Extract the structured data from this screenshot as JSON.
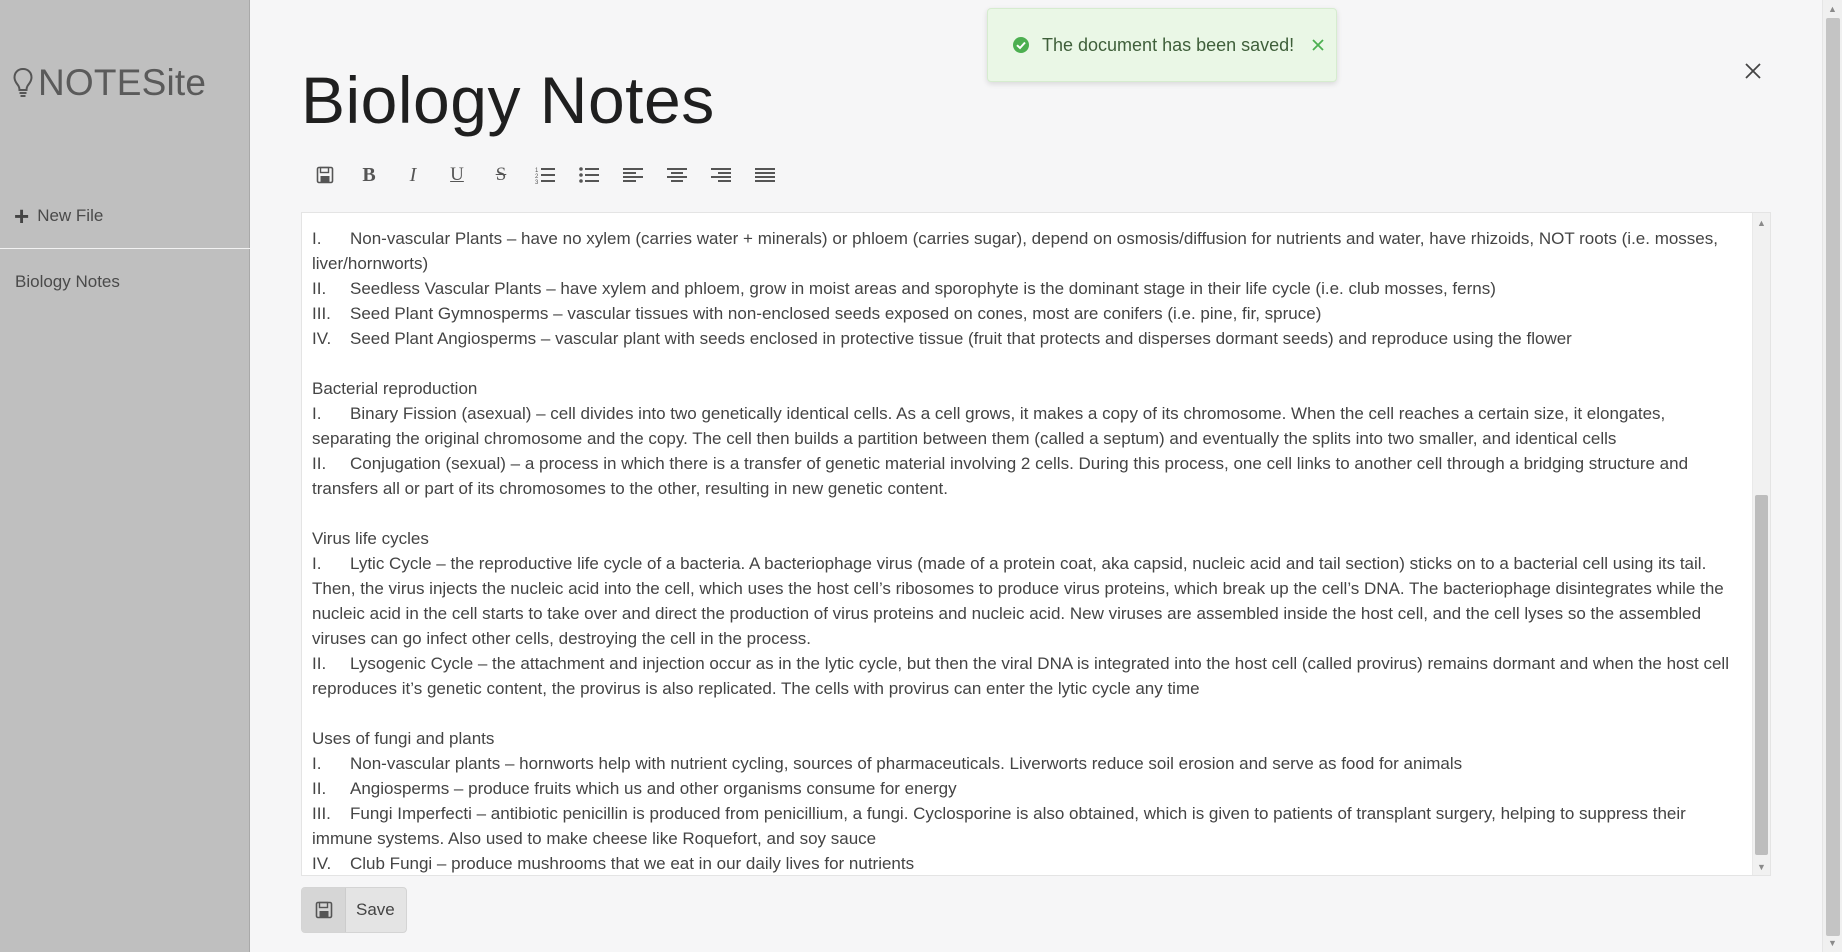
{
  "brand": {
    "name": "NOTESite",
    "icon": "lightbulb-icon"
  },
  "sidebar": {
    "new_file_label": "New File",
    "new_file_icon": "plus-icon",
    "files": [
      "Biology Notes"
    ]
  },
  "document": {
    "title": "Biology Notes"
  },
  "toast": {
    "message": "The document has been saved!",
    "icon": "check-circle-icon",
    "color": "#4caf50"
  },
  "toolbar": {
    "buttons": [
      "save-icon",
      "bold",
      "italic",
      "underline",
      "strikethrough",
      "ordered-list-icon",
      "bullet-list-icon",
      "align-left-icon",
      "align-center-icon",
      "align-right-icon",
      "align-justify-icon"
    ],
    "bold_glyph": "B",
    "italic_glyph": "I",
    "underline_glyph": "U",
    "strike_glyph": "S"
  },
  "content": {
    "plants": [
      {
        "num": "I.",
        "text": "Non-vascular Plants – have no xylem (carries water + minerals) or phloem (carries sugar), depend on osmosis/diffusion for nutrients and water, have rhizoids, NOT roots (i.e. mosses, liver/hornworts)"
      },
      {
        "num": "II.",
        "text": "Seedless Vascular Plants – have xylem and phloem, grow in moist areas and sporophyte is the dominant stage in their life cycle (i.e. club mosses, ferns)"
      },
      {
        "num": "III.",
        "text": "Seed Plant Gymnosperms – vascular tissues with non-enclosed seeds exposed on cones, most are conifers (i.e. pine, fir, spruce)"
      },
      {
        "num": "IV.",
        "text": "Seed Plant Angiosperms – vascular plant with seeds enclosed in protective tissue (fruit that protects and disperses dormant seeds) and reproduce using the flower"
      }
    ],
    "bacterial_heading": "Bacterial reproduction",
    "bacterial": [
      {
        "num": "I.",
        "text": "Binary Fission (asexual) – cell divides into two genetically identical cells. As a cell grows, it makes a copy of its chromosome. When the cell reaches a certain size, it elongates, separating the original chromosome and the copy. The cell then builds a partition between them (called a septum) and eventually the splits into two smaller, and identical cells"
      },
      {
        "num": "II.",
        "text": "Conjugation (sexual) – a process in which there is a transfer of genetic material involving 2 cells. During this process, one cell links to another cell through a bridging structure and transfers all or part of its chromosomes to the other, resulting in new genetic content."
      }
    ],
    "virus_heading": "Virus life cycles",
    "virus": [
      {
        "num": "I.",
        "text": "Lytic Cycle – the reproductive life cycle of a bacteria. A bacteriophage virus (made of a protein coat, aka capsid, nucleic acid and tail section) sticks on to a bacterial cell using its tail. Then, the virus injects the nucleic acid into the cell, which uses the host cell’s ribosomes to produce virus proteins, which break up the cell’s DNA. The bacteriophage disintegrates while the nucleic acid in the cell starts to take over and direct the production of virus proteins and nucleic acid. New viruses are assembled inside the host cell, and the cell lyses so the assembled viruses can go infect other cells, destroying the cell in the process."
      },
      {
        "num": "II.",
        "text": "Lysogenic Cycle – the attachment and injection occur as in the lytic cycle, but then the viral DNA is integrated into the host cell (called provirus) remains dormant and when the host cell reproduces it’s genetic content, the provirus is also replicated. The cells with provirus can enter the lytic cycle any time"
      }
    ],
    "fungi_heading": "Uses of fungi and plants",
    "fungi": [
      {
        "num": "I.",
        "text": "Non-vascular plants – hornworts help with nutrient cycling, sources of pharmaceuticals. Liverworts reduce soil erosion and serve as food for animals"
      },
      {
        "num": "II.",
        "text": "Angiosperms – produce fruits which us and other organisms consume for energy"
      },
      {
        "num": "III.",
        "text": "Fungi Imperfecti – antibiotic penicillin is produced from penicillium, a fungi. Cyclosporine is also obtained, which is given to patients of transplant surgery, helping to suppress their immune systems. Also used to make cheese like Roquefort, and soy sauce"
      },
      {
        "num": "IV.",
        "text": "Club Fungi – produce mushrooms that we eat in our daily lives for nutrients"
      }
    ]
  },
  "footer": {
    "save_label": "Save",
    "save_icon": "save-icon"
  }
}
